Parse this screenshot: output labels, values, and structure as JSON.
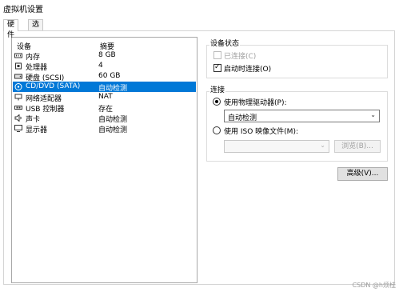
{
  "window": {
    "title": "虚拟机设置"
  },
  "tabs": [
    {
      "label": "硬件",
      "active": true
    },
    {
      "label": "选项",
      "active": false
    }
  ],
  "device_list": {
    "header": {
      "device": "设备",
      "summary": "摘要"
    },
    "rows": [
      {
        "icon": "memory-icon",
        "name": "内存",
        "summary": "8 GB",
        "selected": false
      },
      {
        "icon": "cpu-icon",
        "name": "处理器",
        "summary": "4",
        "selected": false
      },
      {
        "icon": "hdd-icon",
        "name": "硬盘 (SCSI)",
        "summary": "60 GB",
        "selected": false
      },
      {
        "icon": "cd-icon",
        "name": "CD/DVD (SATA)",
        "summary": "自动检测",
        "selected": true
      },
      {
        "icon": "network-icon",
        "name": "网络适配器",
        "summary": "NAT",
        "selected": false
      },
      {
        "icon": "usb-icon",
        "name": "USB 控制器",
        "summary": "存在",
        "selected": false
      },
      {
        "icon": "speaker-icon",
        "name": "声卡",
        "summary": "自动检测",
        "selected": false
      },
      {
        "icon": "monitor-icon",
        "name": "显示器",
        "summary": "自动检测",
        "selected": false
      }
    ]
  },
  "device_status": {
    "title": "设备状态",
    "connected": {
      "label": "已连接(C)",
      "checked": false,
      "enabled": false
    },
    "connect_at_power_on": {
      "label": "启动时连接(O)",
      "checked": true,
      "enabled": true
    }
  },
  "connection": {
    "title": "连接",
    "use_physical": {
      "label": "使用物理驱动器(P):",
      "selected": true
    },
    "physical_select": {
      "value": "自动检测"
    },
    "use_iso": {
      "label": "使用 ISO 映像文件(M):",
      "selected": false
    },
    "iso_select": {
      "value": ""
    },
    "browse_button": "浏览(B)..."
  },
  "advanced_button": "高级(V)...",
  "watermark": "CSDN @h烦桂"
}
